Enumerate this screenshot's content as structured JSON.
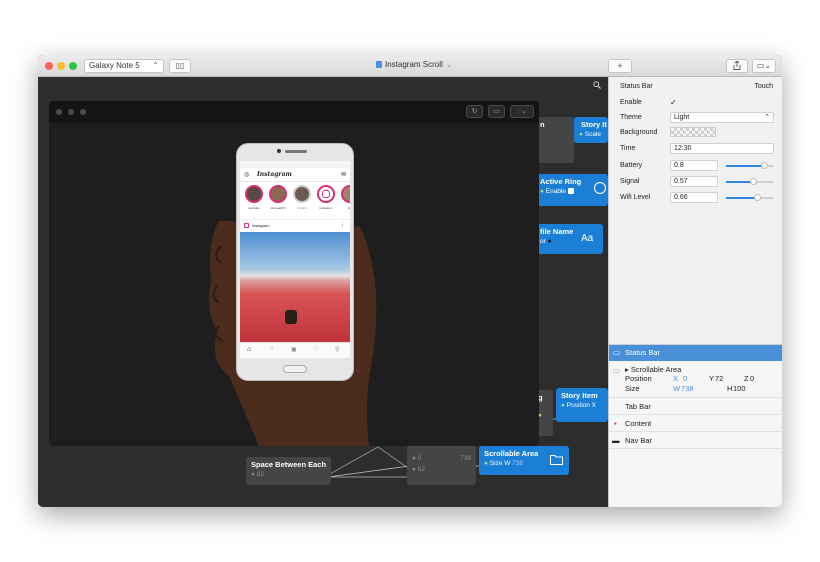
{
  "toolbar": {
    "device": "Galaxy Note 5",
    "title": "Instagram Scroll",
    "add_label": "+"
  },
  "nodes": {
    "n1_title": "n",
    "n1_row": "Scale",
    "story_item_1": "Story It",
    "active_ring": {
      "title": "Active Ring",
      "row": "Enable"
    },
    "profile_name": {
      "title": "file Name",
      "row": "or",
      "badge": "Aa"
    },
    "g_title": "g",
    "story_item_2": {
      "title": "Story Item",
      "row": "Position X"
    },
    "space_between": {
      "title": "Space Between Each",
      "value": "82"
    },
    "middle": {
      "v1": "0",
      "v2": "738",
      "v3": "82"
    },
    "scrollable": {
      "title": "Scrollable Area",
      "row": "Size W",
      "value": "738"
    }
  },
  "phone": {
    "app_name": "Instagram",
    "post_user": "instagram",
    "stories": [
      "donhobo",
      "danyaahhh",
      "shhabs",
      "instagram",
      "phi"
    ]
  },
  "inspector": {
    "header": "Status Bar",
    "touch": "Touch",
    "enable_label": "Enable",
    "enable_value": "✓",
    "theme_label": "Theme",
    "theme_value": "Light",
    "background_label": "Background",
    "time_label": "Time",
    "time_value": "12:30",
    "battery_label": "Battery",
    "battery_value": "0.8",
    "signal_label": "Signal",
    "signal_value": "0.57",
    "wifi_label": "Wifi Level",
    "wifi_value": "0.66"
  },
  "layers": {
    "selected": "Status Bar",
    "scrollable": "Scrollable Area",
    "position_label": "Position",
    "pos_x_label": "X",
    "pos_x": "0",
    "pos_y_label": "Y",
    "pos_y": "72",
    "pos_z_label": "Z",
    "pos_z": "0",
    "size_label": "Size",
    "size_w_label": "W",
    "size_w": "738",
    "size_h_label": "H",
    "size_h": "100",
    "tab_bar": "Tab Bar",
    "content": "Content",
    "nav_bar": "Nav Bar"
  },
  "colors": {
    "accent": "#1b7fd6",
    "selection": "#4a90d9"
  }
}
